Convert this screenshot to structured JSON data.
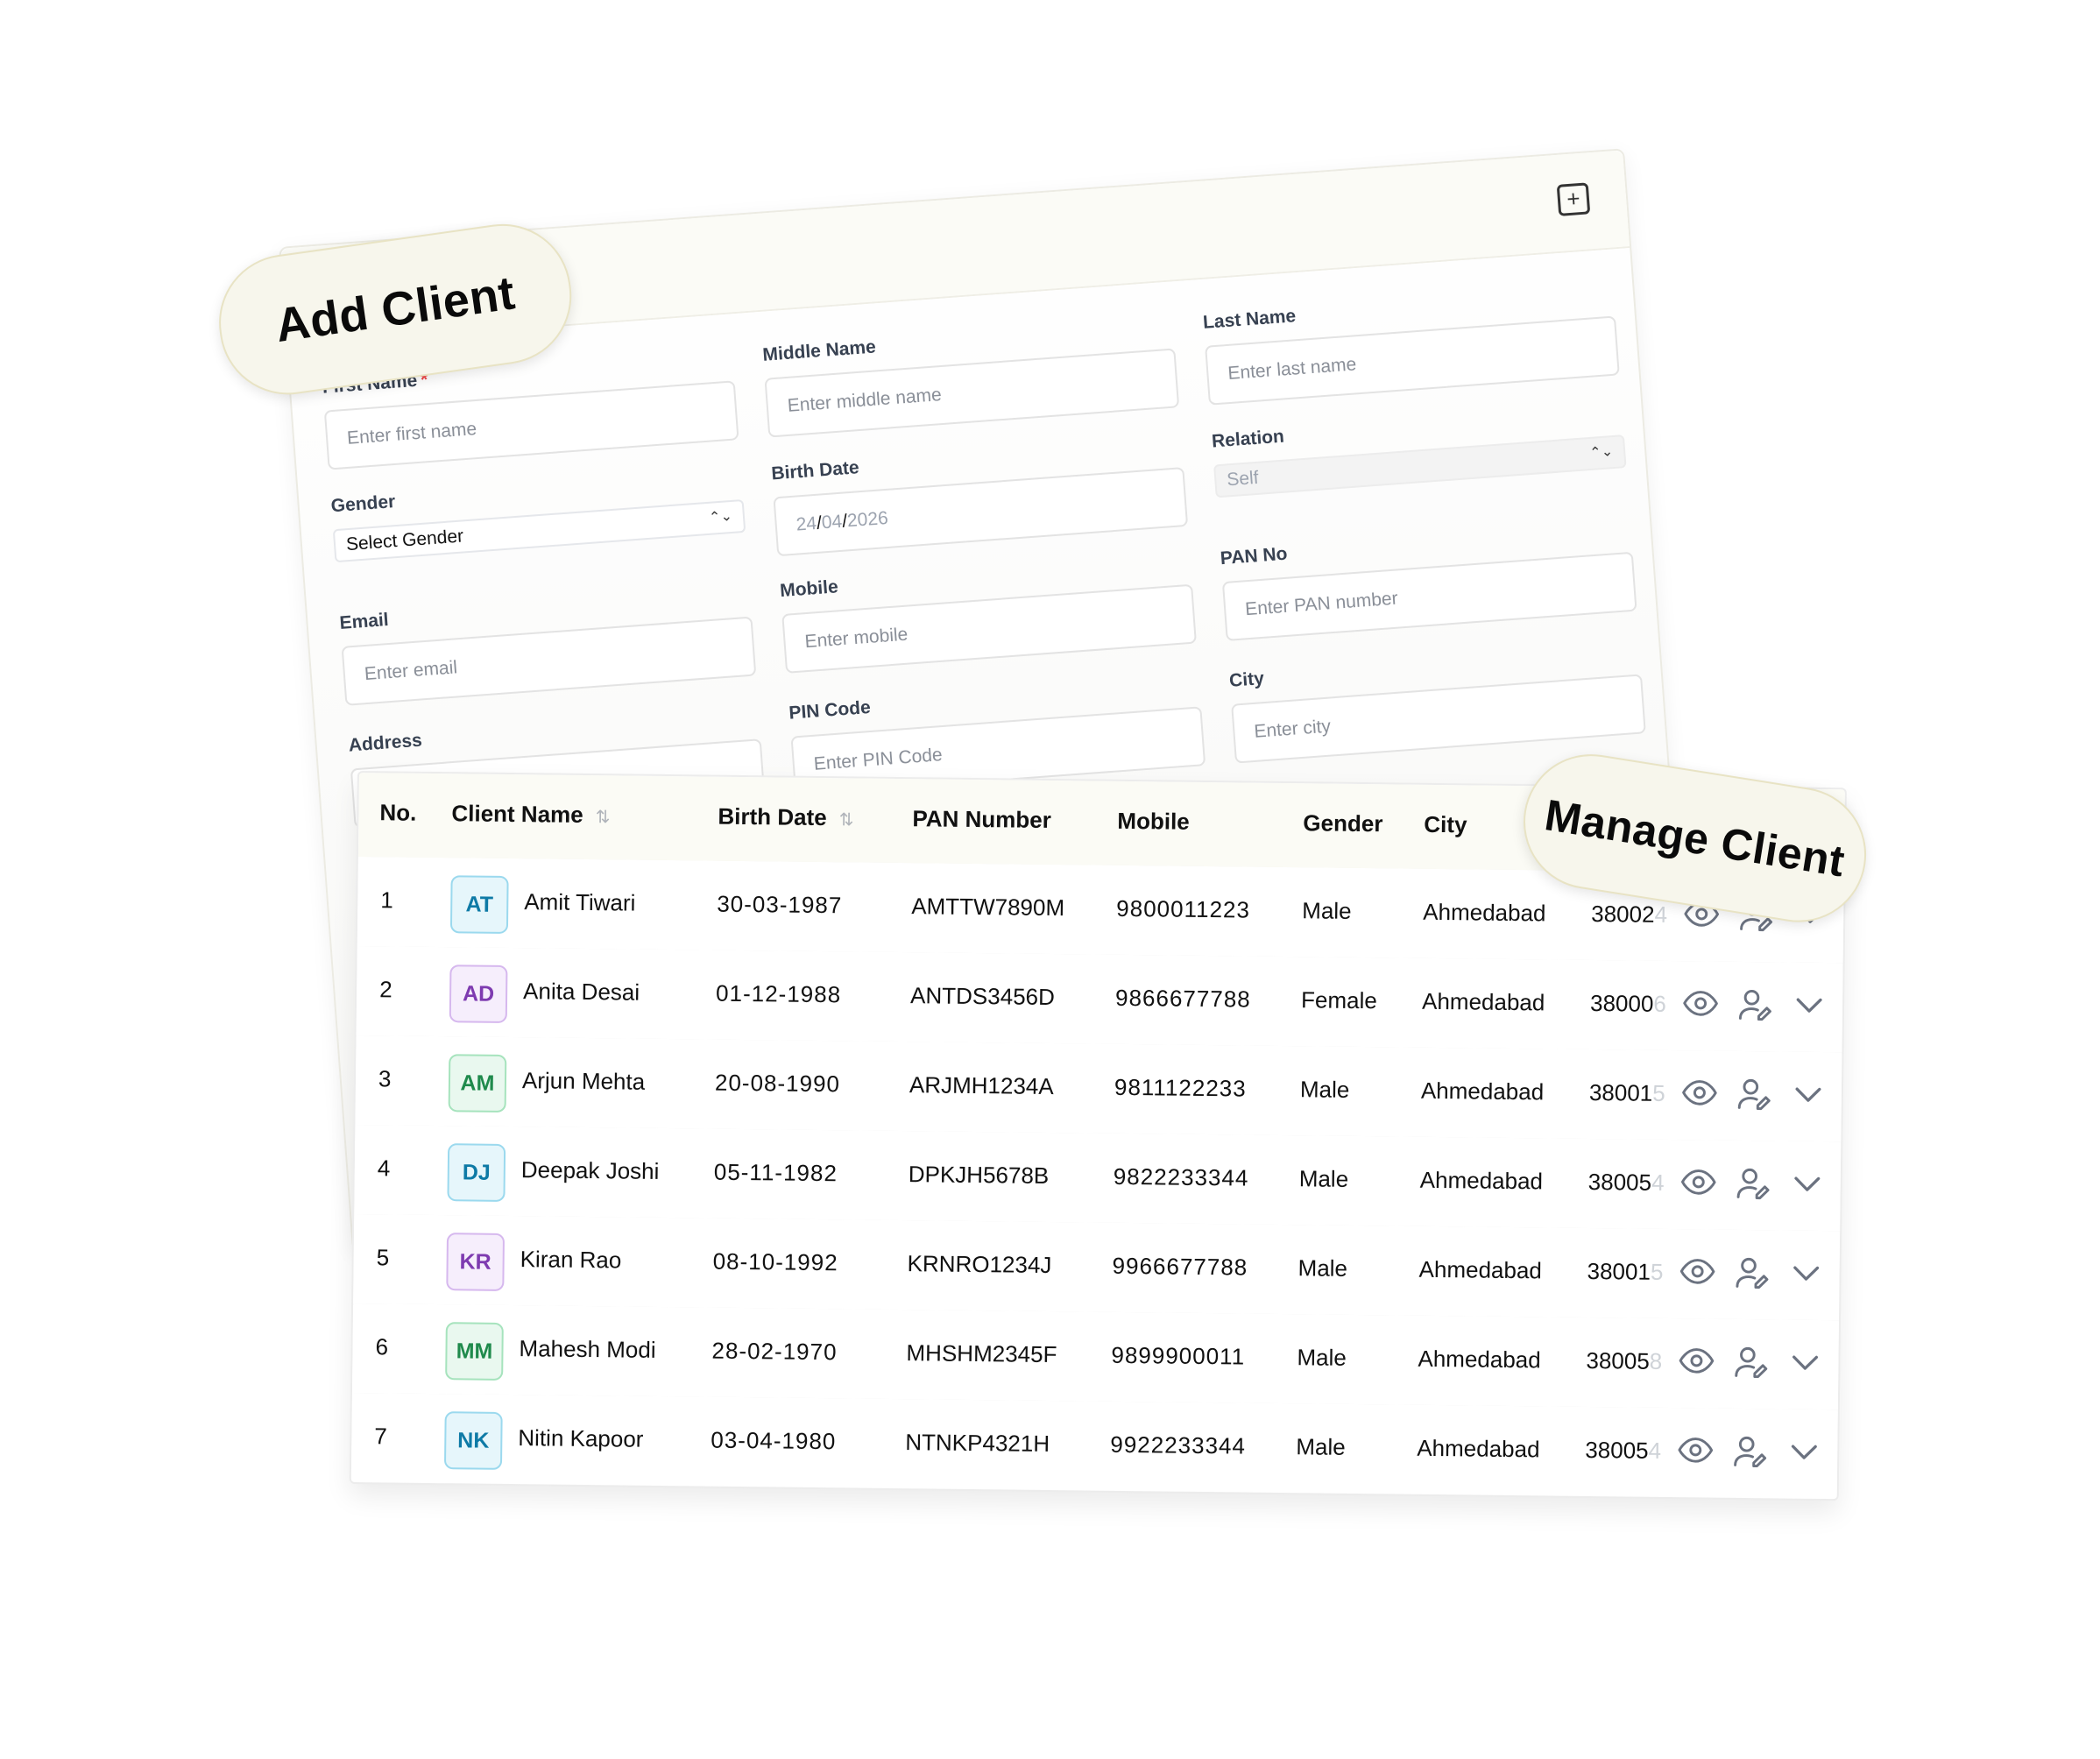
{
  "add_client": {
    "pill_label": "Add Client",
    "add_icon": "plus-square-icon",
    "fields": {
      "first_name": {
        "label": "First Name",
        "required_mark": "*",
        "placeholder": "Enter first name"
      },
      "middle_name": {
        "label": "Middle Name",
        "placeholder": "Enter middle name"
      },
      "last_name": {
        "label": "Last Name",
        "placeholder": "Enter last name"
      },
      "gender": {
        "label": "Gender",
        "value": "Select Gender"
      },
      "birth_date": {
        "label": "Birth Date",
        "day": "24",
        "month": "04",
        "year": "2026",
        "sep": "/"
      },
      "relation": {
        "label": "Relation",
        "value": "Self"
      },
      "email": {
        "label": "Email",
        "placeholder": "Enter email"
      },
      "mobile": {
        "label": "Mobile",
        "placeholder": "Enter mobile"
      },
      "pan_no": {
        "label": "PAN No",
        "placeholder": "Enter PAN number"
      },
      "address": {
        "label": "Address"
      },
      "pin_code": {
        "label": "PIN Code",
        "placeholder": "Enter PIN Code"
      },
      "city": {
        "label": "City",
        "placeholder": "Enter city"
      }
    }
  },
  "manage_client": {
    "pill_label": "Manage Client",
    "columns": [
      "No.",
      "Client Name",
      "Birth Date",
      "PAN Number",
      "Mobile",
      "Gender",
      "City"
    ],
    "sort_icon": "sort-icon",
    "rows": [
      {
        "no": "1",
        "initials": "AT",
        "name": "Amit Tiwari",
        "birth": "30-03-1987",
        "pan": "AMTTW7890M",
        "mobile": "9800011223",
        "gender": "Male",
        "city": "Ahmedabad",
        "pin": "38002",
        "pin_fade": "4",
        "avatar_color": "#0e7aa6",
        "avatar_bg": "#e6f6fb",
        "avatar_border": "#9bd9ee"
      },
      {
        "no": "2",
        "initials": "AD",
        "name": "Anita Desai",
        "birth": "01-12-1988",
        "pan": "ANTDS3456D",
        "mobile": "9866677788",
        "gender": "Female",
        "city": "Ahmedabad",
        "pin": "38000",
        "pin_fade": "6",
        "avatar_color": "#7e3bb0",
        "avatar_bg": "#f6eefc",
        "avatar_border": "#d6b8ee"
      },
      {
        "no": "3",
        "initials": "AM",
        "name": "Arjun Mehta",
        "birth": "20-08-1990",
        "pan": "ARJMH1234A",
        "mobile": "9811122233",
        "gender": "Male",
        "city": "Ahmedabad",
        "pin": "38001",
        "pin_fade": "5",
        "avatar_color": "#1f8a4c",
        "avatar_bg": "#e9f8ef",
        "avatar_border": "#a6e3bd"
      },
      {
        "no": "4",
        "initials": "DJ",
        "name": "Deepak Joshi",
        "birth": "05-11-1982",
        "pan": "DPKJH5678B",
        "mobile": "9822233344",
        "gender": "Male",
        "city": "Ahmedabad",
        "pin": "38005",
        "pin_fade": "4",
        "avatar_color": "#0e7aa6",
        "avatar_bg": "#e6f6fb",
        "avatar_border": "#9bd9ee"
      },
      {
        "no": "5",
        "initials": "KR",
        "name": "Kiran Rao",
        "birth": "08-10-1992",
        "pan": "KRNRO1234J",
        "mobile": "9966677788",
        "gender": "Male",
        "city": "Ahmedabad",
        "pin": "38001",
        "pin_fade": "5",
        "avatar_color": "#7e3bb0",
        "avatar_bg": "#f6eefc",
        "avatar_border": "#d6b8ee"
      },
      {
        "no": "6",
        "initials": "MM",
        "name": "Mahesh Modi",
        "birth": "28-02-1970",
        "pan": "MHSHM2345F",
        "mobile": "9899900011",
        "gender": "Male",
        "city": "Ahmedabad",
        "pin": "38005",
        "pin_fade": "8",
        "avatar_color": "#1f8a4c",
        "avatar_bg": "#e9f8ef",
        "avatar_border": "#a6e3bd"
      },
      {
        "no": "7",
        "initials": "NK",
        "name": "Nitin Kapoor",
        "birth": "03-04-1980",
        "pan": "NTNKP4321H",
        "mobile": "9922233344",
        "gender": "Male",
        "city": "Ahmedabad",
        "pin": "38005",
        "pin_fade": "4",
        "avatar_color": "#0e7aa6",
        "avatar_bg": "#e6f6fb",
        "avatar_border": "#9bd9ee"
      }
    ],
    "row_action_icons": [
      "eye-icon",
      "user-edit-icon",
      "chevron-down-icon"
    ]
  }
}
